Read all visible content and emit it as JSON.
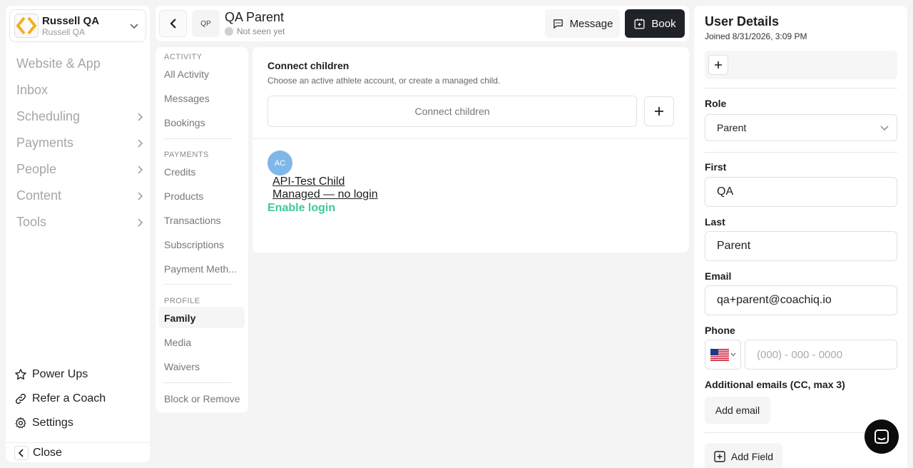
{
  "org": {
    "name": "Russell QA",
    "sub": "Russell QA"
  },
  "nav": {
    "items": [
      {
        "label": "Website & App"
      },
      {
        "label": "Inbox"
      },
      {
        "label": "Scheduling"
      },
      {
        "label": "Payments"
      },
      {
        "label": "People"
      },
      {
        "label": "Content"
      },
      {
        "label": "Tools"
      }
    ],
    "bottom": [
      {
        "label": "Power Ups"
      },
      {
        "label": "Refer a Coach"
      },
      {
        "label": "Settings"
      }
    ],
    "close": "Close"
  },
  "header": {
    "initials": "QP",
    "name": "QA Parent",
    "status": "Not seen yet",
    "message": "Message",
    "book": "Book"
  },
  "subnav": {
    "activity_title": "ACTIVITY",
    "activity": [
      "All Activity",
      "Messages",
      "Bookings"
    ],
    "payments_title": "PAYMENTS",
    "payments": [
      "Credits",
      "Products",
      "Transactions",
      "Subscriptions",
      "Payment Meth..."
    ],
    "profile_title": "PROFILE",
    "profile": [
      "Family",
      "Media",
      "Waivers"
    ],
    "block": "Block or Remove"
  },
  "main": {
    "title": "Connect children",
    "subtitle": "Choose an active athlete account, or create a managed child.",
    "connect_placeholder": "Connect children",
    "child": {
      "initials": "AC",
      "name": "API-Test Child",
      "status": "Managed — no login",
      "enable": "Enable login"
    }
  },
  "user": {
    "title": "User Details",
    "joined": "Joined 8/31/2026, 3:09 PM",
    "role_label": "Role",
    "role_value": "Parent",
    "first_label": "First",
    "first_value": "QA",
    "last_label": "Last",
    "last_value": "Parent",
    "email_label": "Email",
    "email_value": "qa+parent@coachiq.io",
    "phone_label": "Phone",
    "phone_placeholder": "(000) - 000 - 0000",
    "additional_label": "Additional emails (CC, max 3)",
    "add_email": "Add email",
    "add_field": "Add Field"
  },
  "colors": {
    "accent_green": "#3ec99a",
    "dark_button": "#1f2329",
    "avatar_blue": "#7fb7e8"
  }
}
